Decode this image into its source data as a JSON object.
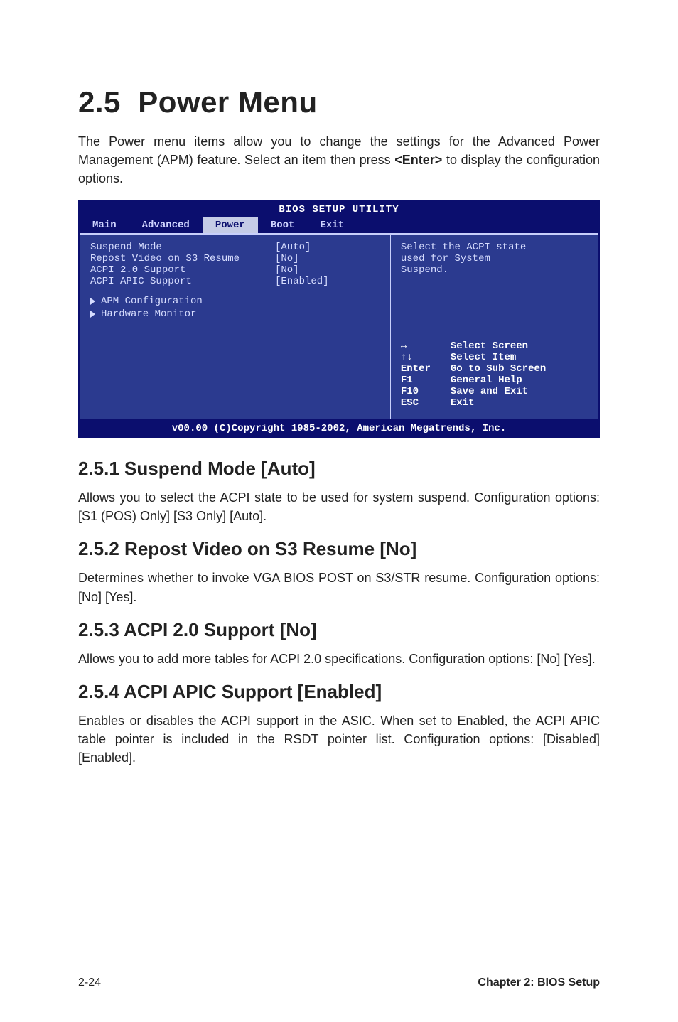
{
  "heading": {
    "number": "2.5",
    "title": "Power Menu"
  },
  "intro": {
    "pre": "The Power menu items allow you to change the settings for the Advanced Power Management (APM) feature. Select an item then press ",
    "key": "<Enter>",
    "post": " to display the configuration options."
  },
  "bios": {
    "title": "BIOS SETUP UTILITY",
    "tabs": [
      "Main",
      "Advanced",
      "Power",
      "Boot",
      "Exit"
    ],
    "active_tab": "Power",
    "items": [
      {
        "label": "Suspend Mode",
        "value": "[Auto]"
      },
      {
        "label": "Repost Video on S3 Resume",
        "value": "[No]"
      },
      {
        "label": "ACPI 2.0 Support",
        "value": "[No]"
      },
      {
        "label": "ACPI APIC Support",
        "value": "[Enabled]"
      }
    ],
    "subs": [
      "APM Configuration",
      "Hardware Monitor"
    ],
    "help_lines": [
      "Select the ACPI state",
      "used for System",
      "Suspend."
    ],
    "keys": [
      {
        "k": "↔",
        "d": "Select Screen"
      },
      {
        "k": "↑↓",
        "d": "Select Item"
      },
      {
        "k": "Enter",
        "d": "Go to Sub Screen"
      },
      {
        "k": "F1",
        "d": "General Help"
      },
      {
        "k": "F10",
        "d": "Save and Exit"
      },
      {
        "k": "ESC",
        "d": "Exit"
      }
    ],
    "footer": "v00.00 (C)Copyright 1985-2002, American Megatrends, Inc."
  },
  "sections": [
    {
      "title": "2.5.1 Suspend Mode [Auto]",
      "body": "Allows you to select the ACPI state to be used for system suspend. Configuration options: [S1 (POS) Only] [S3 Only] [Auto]."
    },
    {
      "title": "2.5.2 Repost Video on S3 Resume [No]",
      "body": "Determines whether to invoke VGA BIOS POST on S3/STR resume. Configuration options: [No] [Yes]."
    },
    {
      "title": "2.5.3 ACPI 2.0 Support [No]",
      "body": "Allows you to add more tables for ACPI 2.0 specifications. Configuration options: [No] [Yes]."
    },
    {
      "title": "2.5.4 ACPI APIC Support [Enabled]",
      "body": "Enables or disables the ACPI support in the ASIC. When set to Enabled, the ACPI APIC table pointer is included in the RSDT pointer list. Configuration options: [Disabled] [Enabled]."
    }
  ],
  "footer": {
    "left": "2-24",
    "right": "Chapter 2: BIOS Setup"
  }
}
